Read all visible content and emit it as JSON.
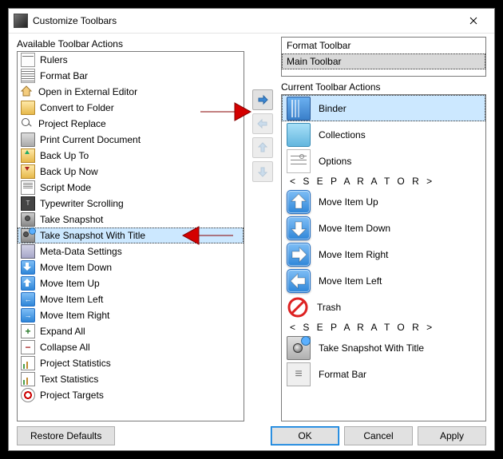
{
  "window": {
    "title": "Customize Toolbars"
  },
  "labels": {
    "available": "Available Toolbar Actions",
    "current": "Current Toolbar Actions"
  },
  "available_actions": [
    {
      "name": "Rulers"
    },
    {
      "name": "Format Bar"
    },
    {
      "name": "Open in External Editor"
    },
    {
      "name": "Convert to Folder"
    },
    {
      "name": "Project Replace"
    },
    {
      "name": "Print Current Document"
    },
    {
      "name": "Back Up To"
    },
    {
      "name": "Back Up Now"
    },
    {
      "name": "Script Mode"
    },
    {
      "name": "Typewriter Scrolling"
    },
    {
      "name": "Take Snapshot"
    },
    {
      "name": "Take Snapshot With Title",
      "selected": true
    },
    {
      "name": "Meta-Data Settings"
    },
    {
      "name": "Move Item Down"
    },
    {
      "name": "Move Item Up"
    },
    {
      "name": "Move Item Left"
    },
    {
      "name": "Move Item Right"
    },
    {
      "name": "Expand All"
    },
    {
      "name": "Collapse All"
    },
    {
      "name": "Project Statistics"
    },
    {
      "name": "Text Statistics"
    },
    {
      "name": "Project Targets"
    }
  ],
  "toolbars": [
    {
      "name": "Format Toolbar"
    },
    {
      "name": "Main Toolbar",
      "selected": true
    }
  ],
  "current_actions": [
    {
      "name": "Binder",
      "selected": true
    },
    {
      "name": "Collections"
    },
    {
      "name": "Options"
    },
    {
      "separator": "< S E P A R A T O R >"
    },
    {
      "name": "Move Item Up"
    },
    {
      "name": "Move Item Down"
    },
    {
      "name": "Move Item Right"
    },
    {
      "name": "Move Item Left"
    },
    {
      "name": "Trash"
    },
    {
      "separator": "< S E P A R A T O R >"
    },
    {
      "name": "Take Snapshot With Title"
    },
    {
      "name": "Format Bar"
    }
  ],
  "buttons": {
    "restore": "Restore Defaults",
    "ok": "OK",
    "cancel": "Cancel",
    "apply": "Apply"
  }
}
